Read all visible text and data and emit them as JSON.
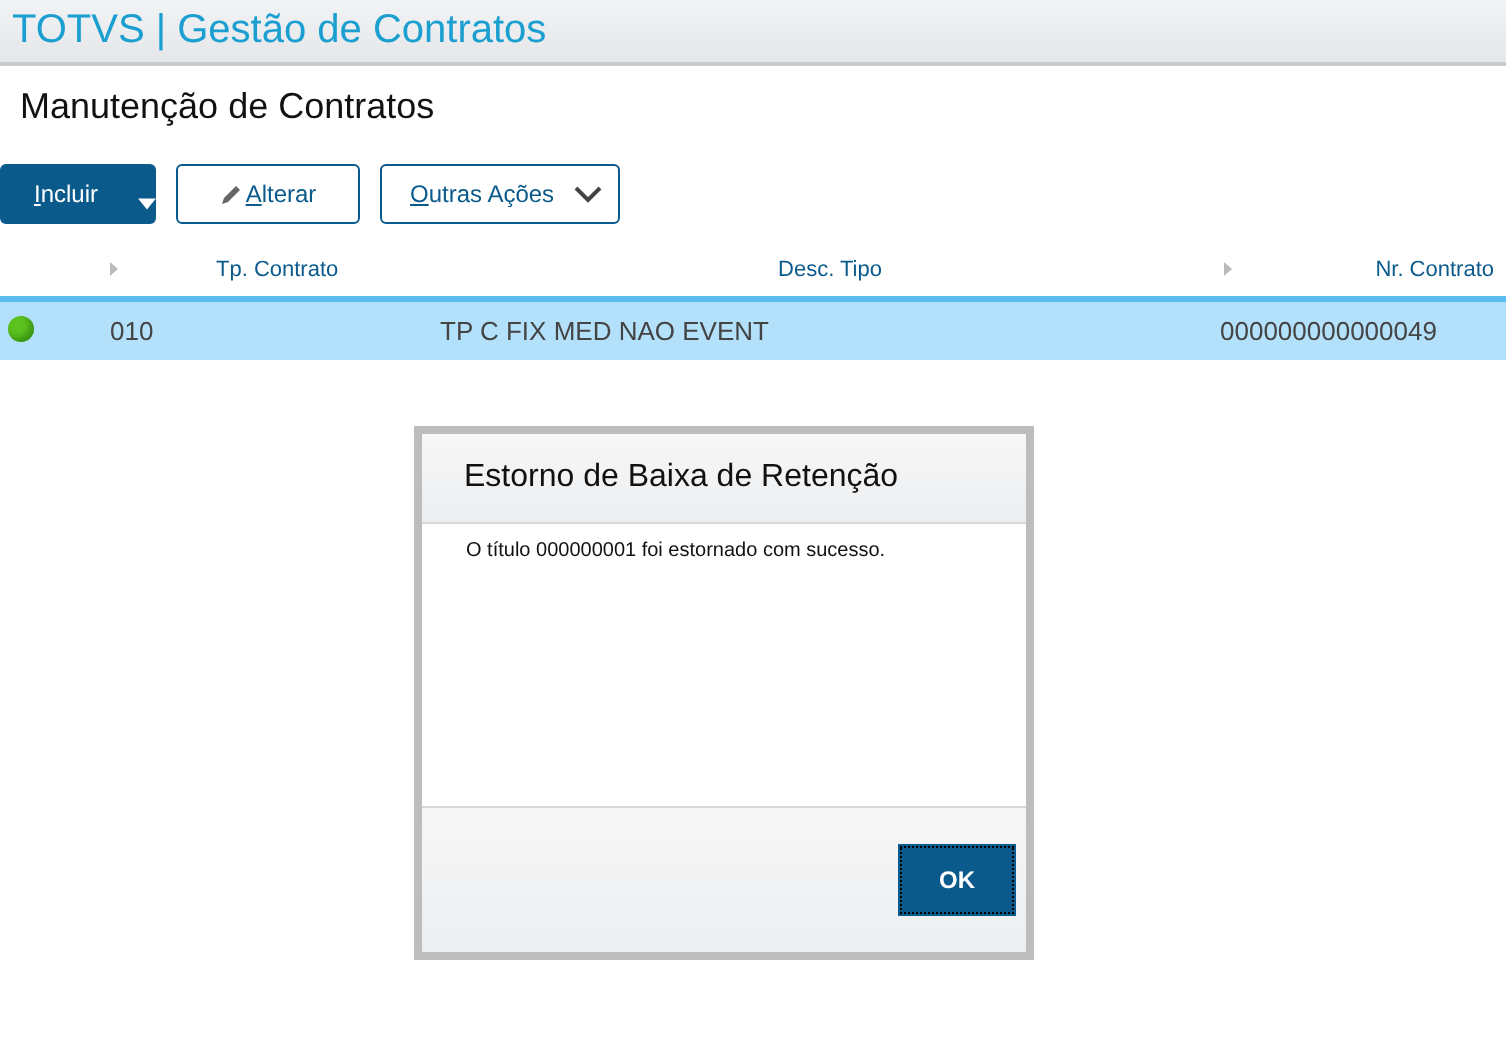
{
  "app_title": "TOTVS | Gestão de Contratos",
  "page_title": "Manutenção de Contratos",
  "toolbar": [
    {
      "label": "Incluir",
      "kind": "primary-dropdown"
    },
    {
      "label": "Alterar",
      "kind": "edit"
    },
    {
      "label": "Outras Ações",
      "kind": "dropdown"
    }
  ],
  "table": {
    "columns": [
      "Tp. Contrato",
      "Desc. Tipo",
      "Nr. Contrato"
    ],
    "rows": [
      {
        "selected": true,
        "color": "#5cc21e",
        "cells": [
          "010",
          "TP C FIX MED NAO EVENT",
          "000000000000049"
        ]
      }
    ]
  },
  "dialog": {
    "title": "Estorno de Baixa de Retenção",
    "message": "O título 000000001 foi estornado com sucesso.",
    "button": "OK"
  }
}
